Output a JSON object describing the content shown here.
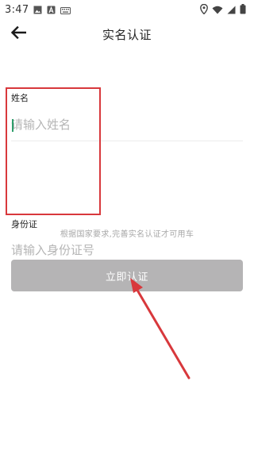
{
  "status_bar": {
    "time": "3:47",
    "left_icons": [
      "image-icon",
      "app-a-icon",
      "keyboard-icon"
    ],
    "right_icons": [
      "location-icon",
      "wifi-icon",
      "signal-icon",
      "battery-icon"
    ]
  },
  "header": {
    "title": "实名认证",
    "back_icon": "arrow-left-icon"
  },
  "form": {
    "name_field": {
      "label": "姓名",
      "placeholder": "请输入姓名",
      "value": ""
    },
    "id_field": {
      "label": "身份证",
      "placeholder": "请输入身份证号",
      "value": ""
    }
  },
  "notice": "根据国家要求,完善实名认证才可用车",
  "submit_button": {
    "label": "立即认证"
  },
  "colors": {
    "button_bg": "#b5b4b5",
    "annotation": "#d8383c",
    "placeholder": "#b5b5b5",
    "caret": "#2e9e6b"
  }
}
